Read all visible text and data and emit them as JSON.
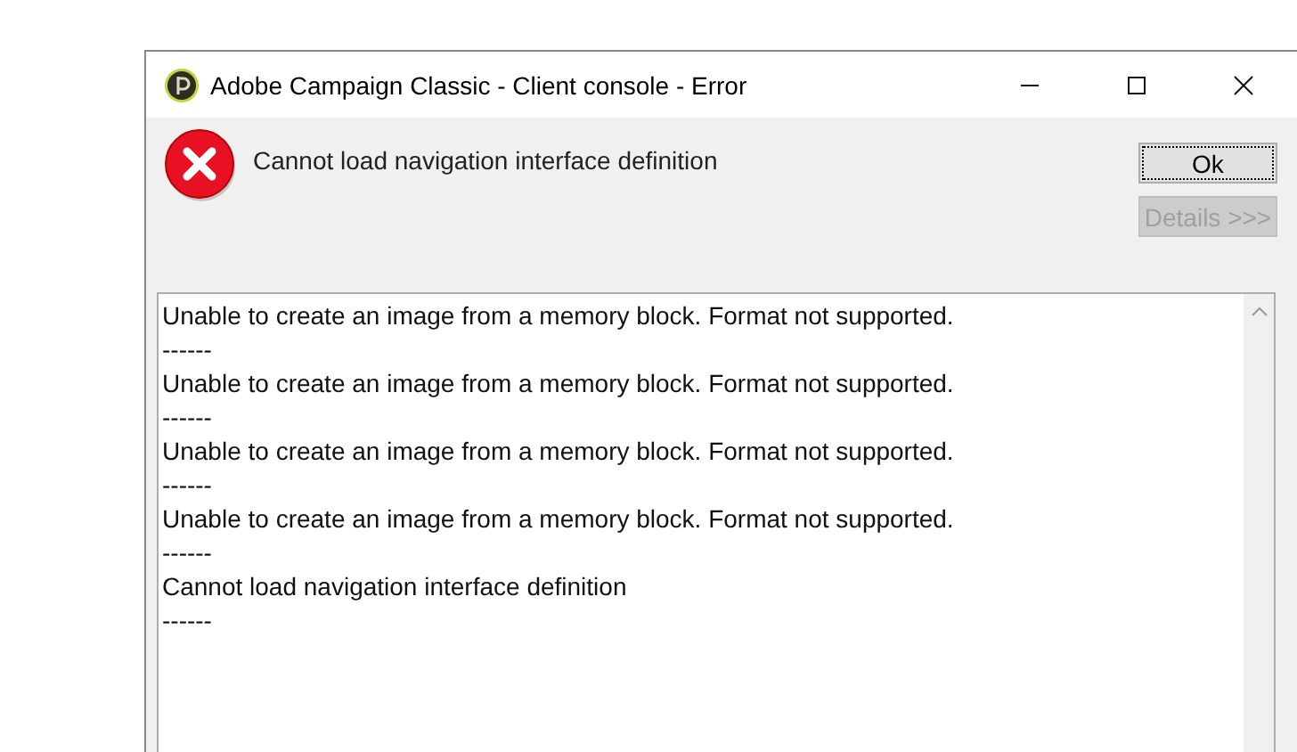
{
  "window": {
    "title": "Adobe Campaign Classic - Client console - Error"
  },
  "message": "Cannot load navigation interface definition",
  "buttons": [
    {
      "label": "Ok",
      "disabled": false,
      "focused": true
    },
    {
      "label": "Details >>>",
      "disabled": true,
      "focused": false
    }
  ],
  "log": [
    "Unable to create an image from a memory block. Format not supported.",
    "------",
    "Unable to create an image from a memory block. Format not supported.",
    "------",
    "Unable to create an image from a memory block. Format not supported.",
    "------",
    "Unable to create an image from a memory block. Format not supported.",
    "------",
    "Cannot load navigation interface definition",
    "------"
  ]
}
